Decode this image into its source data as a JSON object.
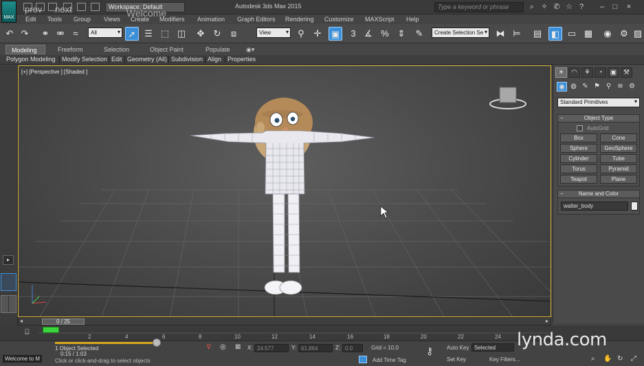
{
  "titlebar": {
    "app_title": "Autodesk 3ds Max 2015",
    "workspace": "Workspace: Default",
    "search_placeholder": "Type a keyword or phrase",
    "nav_prev": "prev",
    "nav_next": "next",
    "overlay_welcome": "Welcome",
    "logo_text": "MAX"
  },
  "menu": [
    "Edit",
    "Tools",
    "Group",
    "Views",
    "Create",
    "Modifiers",
    "Animation",
    "Graph Editors",
    "Rendering",
    "Customize",
    "MAXScript",
    "Help"
  ],
  "toolbar": {
    "filter_dd": "All",
    "refcoord_dd": "View",
    "selection_set": "Create Selection Se",
    "snap_label": "3"
  },
  "ribbon": {
    "tabs": [
      "Modeling",
      "Freeform",
      "Selection",
      "Object Paint",
      "Populate"
    ],
    "sub_items": [
      "Polygon Modeling",
      "Modify Selection",
      "Edit",
      "Geometry (All)",
      "Subdivision",
      "Align",
      "Properties"
    ]
  },
  "viewport": {
    "label": "[+] [Perspective ] [Shaded ]"
  },
  "command_panel": {
    "category_dd": "Standard Primitives",
    "object_type_title": "Object Type",
    "autogrid": "AutoGrid",
    "primitives": [
      "Box",
      "Cone",
      "Sphere",
      "GeoSphere",
      "Cylinder",
      "Tube",
      "Torus",
      "Pyramid",
      "Teapot",
      "Plane"
    ],
    "name_color_title": "Name and Color",
    "object_name": "walter_body"
  },
  "timeline": {
    "frame_display": "0 / 25",
    "ticks": [
      "2",
      "4",
      "6",
      "8",
      "10",
      "12",
      "14",
      "16",
      "18",
      "20",
      "22",
      "24"
    ]
  },
  "status": {
    "selected_count": "1 Object Selected",
    "prompt": "Click or click-and-drag to select objects",
    "x_label": "X:",
    "x_value": "24.577",
    "y_label": "Y:",
    "y_value": "61.864",
    "z_label": "Z:",
    "z_value": "0.0",
    "grid": "Grid = 10.0",
    "auto_key": "Auto Key",
    "set_key": "Set Key",
    "selected_dd": "Selected",
    "key_filters": "Key Filters...",
    "add_time_tag": "Add Time Tag",
    "welcome_tab": "Welcome to M",
    "timecode": "0:15 / 1:03"
  },
  "watermark": "lynda.com",
  "colors": {
    "accent": "#3b8fd8",
    "viewport_border": "#d8b339",
    "key_green": "#3bd63b"
  }
}
